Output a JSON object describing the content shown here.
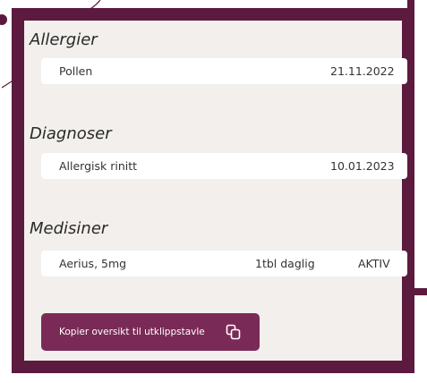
{
  "sections": [
    {
      "title": "Allergier",
      "row": {
        "name": "Pollen",
        "date": "21.11.2022"
      }
    },
    {
      "title": "Diagnoser",
      "row": {
        "name": "Allergisk rinitt",
        "date": "10.01.2023"
      }
    },
    {
      "title": "Medisiner",
      "row": {
        "name": "Aerius, 5mg",
        "dosage": "1tbl daglig",
        "status": "AKTIV"
      }
    }
  ],
  "copy_button": {
    "label": "Kopier oversikt til utklippstavle",
    "icon": "copy-icon"
  },
  "colors": {
    "frame": "#5b1a3e",
    "background": "#f2efec",
    "button": "#7a2a57",
    "card": "#ffffff"
  }
}
